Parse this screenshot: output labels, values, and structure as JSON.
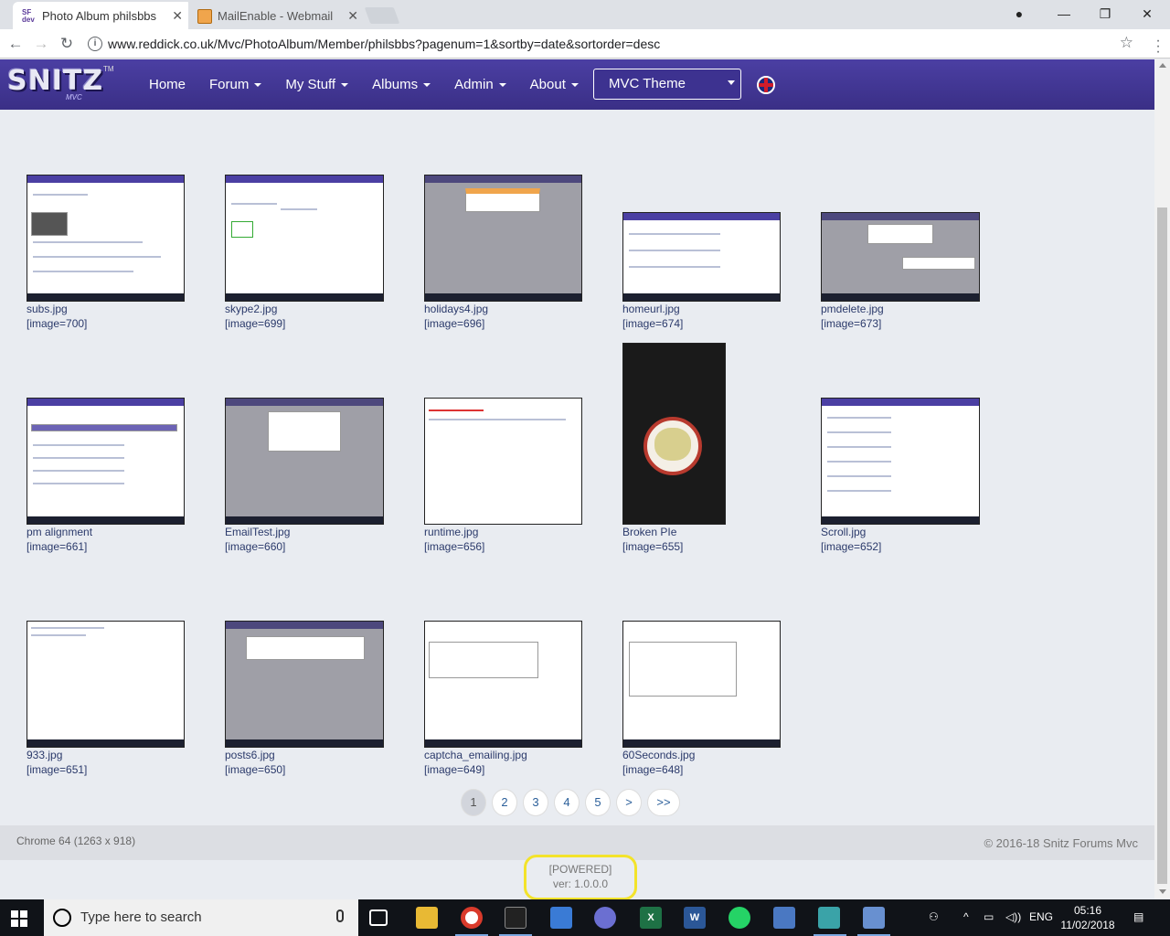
{
  "browser": {
    "tabs": [
      {
        "title": "Photo Album philsbbs",
        "active": true
      },
      {
        "title": "MailEnable - Webmail",
        "active": false
      }
    ],
    "url": "www.reddick.co.uk/Mvc/PhotoAlbum/Member/philsbbs?pagenum=1&sortby=date&sortorder=desc"
  },
  "site": {
    "logo_text": "SNITZ",
    "logo_sub": "MVC",
    "logo_tm": "TM",
    "menu": [
      {
        "label": "Home",
        "dropdown": false
      },
      {
        "label": "Forum",
        "dropdown": true
      },
      {
        "label": "My Stuff",
        "dropdown": true
      },
      {
        "label": "Albums",
        "dropdown": true
      },
      {
        "label": "Admin",
        "dropdown": true
      },
      {
        "label": "About",
        "dropdown": true
      }
    ],
    "theme_select": "MVC Theme"
  },
  "photos": [
    {
      "name": "subs.jpg",
      "id": "[image=700]"
    },
    {
      "name": "skype2.jpg",
      "id": "[image=699]"
    },
    {
      "name": "holidays4.jpg",
      "id": "[image=696]"
    },
    {
      "name": "homeurl.jpg",
      "id": "[image=674]"
    },
    {
      "name": "pmdelete.jpg",
      "id": "[image=673]"
    },
    {
      "name": "pm alignment",
      "id": "[image=661]"
    },
    {
      "name": "EmailTest.jpg",
      "id": "[image=660]"
    },
    {
      "name": "runtime.jpg",
      "id": "[image=656]"
    },
    {
      "name": "Broken PIe",
      "id": "[image=655]"
    },
    {
      "name": "Scroll.jpg",
      "id": "[image=652]"
    },
    {
      "name": "933.jpg",
      "id": "[image=651]"
    },
    {
      "name": "posts6.jpg",
      "id": "[image=650]"
    },
    {
      "name": "captcha_emailing.jpg",
      "id": "[image=649]"
    },
    {
      "name": "60Seconds.jpg",
      "id": "[image=648]"
    }
  ],
  "pager": [
    "1",
    "2",
    "3",
    "4",
    "5",
    ">",
    ">>"
  ],
  "pager_active": "1",
  "footer": {
    "left": "Chrome 64 (1263 x 918)",
    "right": "© 2016-18 Snitz Forums Mvc",
    "powered": "[POWERED]",
    "version": "ver: 1.0.0.0"
  },
  "taskbar": {
    "search_placeholder": "Type here to search",
    "language": "ENG",
    "time": "05:16",
    "date": "11/02/2018"
  }
}
